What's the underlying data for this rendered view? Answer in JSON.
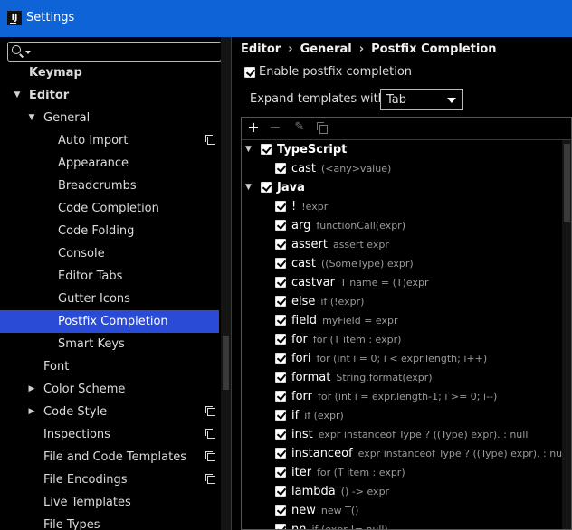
{
  "window": {
    "app_icon": "IJ",
    "title": "Settings"
  },
  "sidebar": {
    "search": {
      "value": "",
      "placeholder": ""
    },
    "items": [
      {
        "label": "Keymap",
        "level": 0,
        "expand": "none",
        "bold": true
      },
      {
        "label": "Editor",
        "level": 0,
        "expand": "expanded",
        "bold": true
      },
      {
        "label": "General",
        "level": 1,
        "expand": "expanded"
      },
      {
        "label": "Auto Import",
        "level": 2,
        "expand": "none",
        "project_icon": true
      },
      {
        "label": "Appearance",
        "level": 2,
        "expand": "none"
      },
      {
        "label": "Breadcrumbs",
        "level": 2,
        "expand": "none"
      },
      {
        "label": "Code Completion",
        "level": 2,
        "expand": "none"
      },
      {
        "label": "Code Folding",
        "level": 2,
        "expand": "none"
      },
      {
        "label": "Console",
        "level": 2,
        "expand": "none"
      },
      {
        "label": "Editor Tabs",
        "level": 2,
        "expand": "none"
      },
      {
        "label": "Gutter Icons",
        "level": 2,
        "expand": "none"
      },
      {
        "label": "Postfix Completion",
        "level": 2,
        "expand": "none",
        "selected": true
      },
      {
        "label": "Smart Keys",
        "level": 2,
        "expand": "none"
      },
      {
        "label": "Font",
        "level": 1,
        "expand": "none"
      },
      {
        "label": "Color Scheme",
        "level": 1,
        "expand": "collapsed"
      },
      {
        "label": "Code Style",
        "level": 1,
        "expand": "collapsed",
        "project_icon": true
      },
      {
        "label": "Inspections",
        "level": 1,
        "expand": "none",
        "project_icon": true
      },
      {
        "label": "File and Code Templates",
        "level": 1,
        "expand": "none",
        "project_icon": true
      },
      {
        "label": "File Encodings",
        "level": 1,
        "expand": "none",
        "project_icon": true
      },
      {
        "label": "Live Templates",
        "level": 1,
        "expand": "none"
      },
      {
        "label": "File Types",
        "level": 1,
        "expand": "none"
      }
    ]
  },
  "breadcrumb": [
    "Editor",
    "General",
    "Postfix Completion"
  ],
  "breadcrumb_separator": "›",
  "enable_postfix": {
    "label": "Enable postfix completion",
    "checked": true
  },
  "expand_with": {
    "label": "Expand templates with",
    "value": "Tab"
  },
  "toolbar": {
    "add": "+",
    "remove": "−",
    "edit": "✎"
  },
  "templates": [
    {
      "key": "TypeScript",
      "group": true,
      "checked": true
    },
    {
      "key": "cast",
      "desc": "(<any>value)",
      "checked": true
    },
    {
      "key": "Java",
      "group": true,
      "checked": true
    },
    {
      "key": "!",
      "desc": "!expr",
      "checked": true
    },
    {
      "key": "arg",
      "desc": "functionCall(expr)",
      "checked": true
    },
    {
      "key": "assert",
      "desc": "assert expr",
      "checked": true
    },
    {
      "key": "cast",
      "desc": "((SomeType) expr)",
      "checked": true
    },
    {
      "key": "castvar",
      "desc": "T name = (T)expr",
      "checked": true
    },
    {
      "key": "else",
      "desc": "if (!expr)",
      "checked": true
    },
    {
      "key": "field",
      "desc": "myField = expr",
      "checked": true
    },
    {
      "key": "for",
      "desc": "for (T item : expr)",
      "checked": true
    },
    {
      "key": "fori",
      "desc": "for (int i = 0; i < expr.length; i++)",
      "checked": true
    },
    {
      "key": "format",
      "desc": "String.format(expr)",
      "checked": true
    },
    {
      "key": "forr",
      "desc": "for (int i = expr.length-1; i >= 0; i--)",
      "checked": true
    },
    {
      "key": "if",
      "desc": "if (expr)",
      "checked": true
    },
    {
      "key": "inst",
      "desc": "expr instanceof Type ? ((Type) expr). : null",
      "checked": true
    },
    {
      "key": "instanceof",
      "desc": "expr instanceof Type ? ((Type) expr). : null",
      "checked": true
    },
    {
      "key": "iter",
      "desc": "for (T item : expr)",
      "checked": true
    },
    {
      "key": "lambda",
      "desc": "() -> expr",
      "checked": true
    },
    {
      "key": "new",
      "desc": "new T()",
      "checked": true
    },
    {
      "key": "nn",
      "desc": "if (expr != null)",
      "checked": true
    }
  ],
  "colors": {
    "titlebar": "#0e64d6",
    "selection": "#2a4bd6",
    "background": "#000000"
  }
}
